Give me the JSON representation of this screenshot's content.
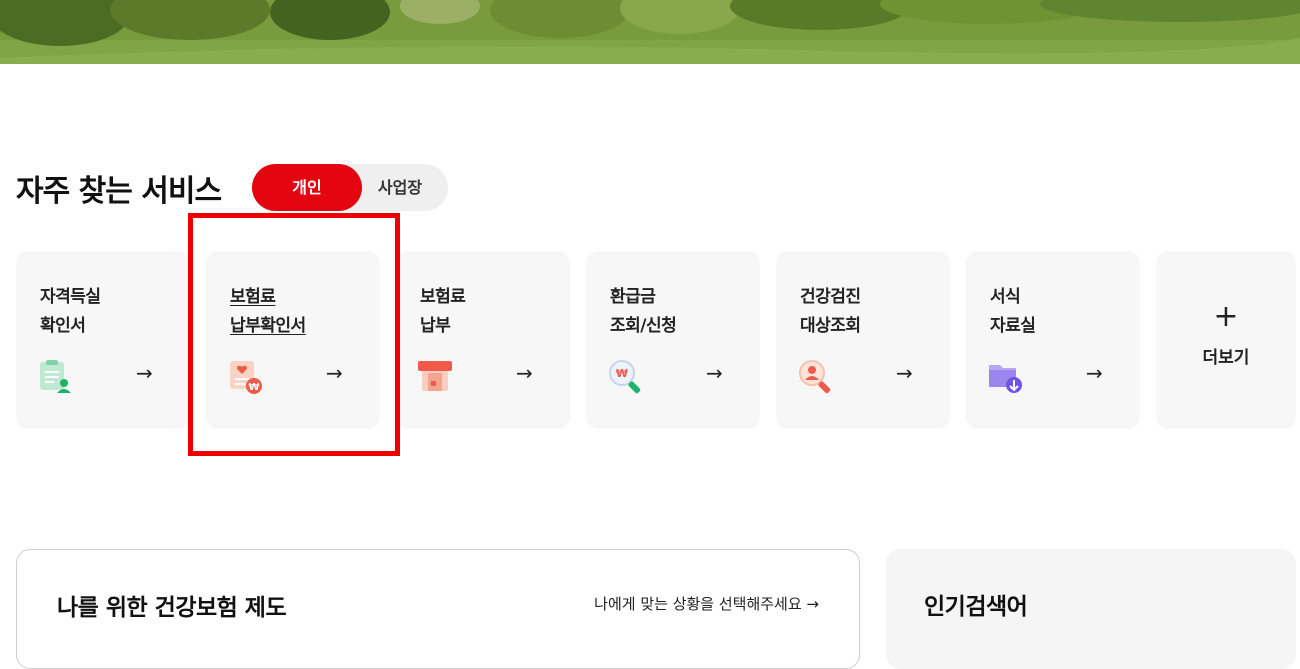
{
  "section": {
    "title": "자주 찾는 서비스",
    "toggle": {
      "active": "개인",
      "inactive": "사업장"
    }
  },
  "cards": [
    {
      "line1": "자격득실",
      "line2": "확인서",
      "icon": "document-person-icon"
    },
    {
      "line1": "보험료",
      "line2": "납부확인서",
      "icon": "certificate-won-icon"
    },
    {
      "line1": "보험료",
      "line2": "납부",
      "icon": "card-payment-icon"
    },
    {
      "line1": "환급금",
      "line2": "조회/신청",
      "icon": "search-won-icon"
    },
    {
      "line1": "건강검진",
      "line2": "대상조회",
      "icon": "search-person-icon"
    },
    {
      "line1": "서식",
      "line2": "자료실",
      "icon": "folder-download-icon"
    }
  ],
  "arrow": "→",
  "more": {
    "plus": "+",
    "label": "더보기"
  },
  "panels": {
    "left": {
      "title": "나를 위한 건강보험 제도",
      "link": "나에게 맞는 상황을 선택해주세요 →"
    },
    "right": {
      "title": "인기검색어"
    }
  },
  "colors": {
    "accent": "#e3050f",
    "highlight": "#ee0000"
  }
}
